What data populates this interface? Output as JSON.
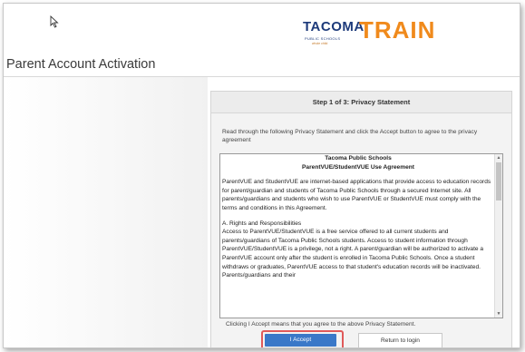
{
  "logo": {
    "word": "TACOMA",
    "subtitle": "PUBLIC SCHOOLS",
    "tagline": "whole child",
    "train": "TRAIN"
  },
  "page": {
    "title": "Parent Account Activation"
  },
  "card": {
    "header": "Step 1 of 3: Privacy Statement",
    "intro": "Read through the following Privacy Statement and click the Accept button to agree to the privacy agreement",
    "agreement": {
      "org": "Tacoma Public Schools",
      "title": "ParentVUE/StudentVUE Use Agreement",
      "paragraph1": "ParentVUE and StudentVUE are internet-based applications that provide access to education records for parent/guardian and students of Tacoma Public Schools through a secured Internet site. All parents/guardians and students who wish to use ParentVUE or StudentVUE must comply with the terms and conditions in this Agreement.",
      "section_a": "A. Rights and Responsibilities",
      "paragraph2": "Access to ParentVUE/StudentVUE is a free service offered to all current students and parents/guardians of Tacoma Public Schools students. Access to student information through ParentVUE/StudentVUE is a privilege, not a right. A parent/guardian will be authorized to activate a ParentVUE account only after the student is enrolled in Tacoma Public Schools. Once a student withdraws or graduates, ParentVUE access to that student's education records will be inactivated. Parents/guardians and their"
    },
    "consent": "Clicking I Accept means that you agree to the above Privacy Statement.",
    "accept_label": "I Accept",
    "return_label": "Return to login"
  }
}
